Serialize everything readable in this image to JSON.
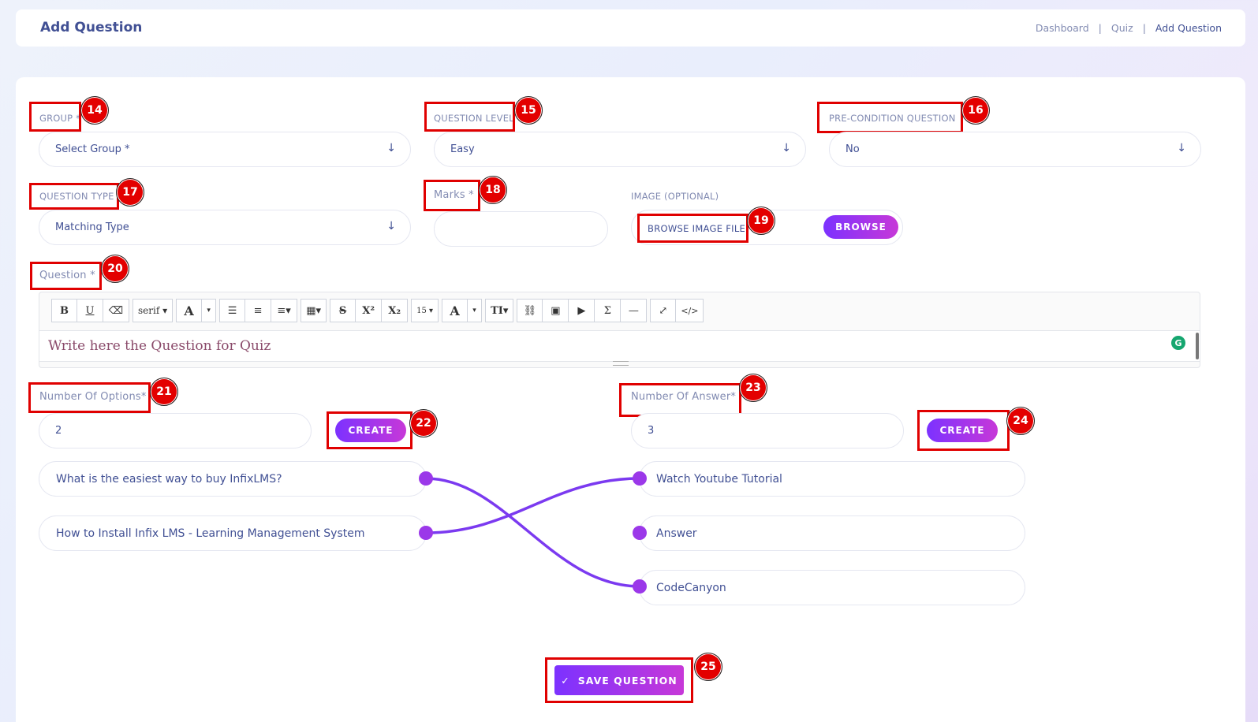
{
  "header": {
    "title": "Add Question",
    "breadcrumb": [
      "Dashboard",
      "|",
      "Quiz",
      "|",
      "Add Question"
    ]
  },
  "form": {
    "group_label": "GROUP *",
    "group_value": "Select Group *",
    "level_label": "QUESTION LEVEL",
    "level_value": "Easy",
    "precond_label": "PRE-CONDITION QUESTION",
    "precond_value": "No",
    "type_label": "QUESTION TYPE",
    "type_value": "Matching Type",
    "marks_label": "Marks *",
    "marks_value": "",
    "image_label": "IMAGE (OPTIONAL)",
    "image_placeholder": "BROWSE IMAGE FILE",
    "browse_label": "BROWSE",
    "question_label": "Question *",
    "question_placeholder": "Write here the Question for Quiz",
    "num_options_label": "Number Of Options*",
    "num_options_value": "2",
    "num_answer_label": "Number Of Answer*",
    "num_answer_value": "3",
    "create_label": "CREATE",
    "save_label": "SAVE QUESTION",
    "save_icon": "✓"
  },
  "editor": {
    "font_name": "serif",
    "font_size": "15"
  },
  "options": [
    "What is the easiest way to buy InfixLMS?",
    "How to Install Infix LMS - Learning Management System"
  ],
  "answers": [
    "Watch Youtube Tutorial",
    "Answer",
    "CodeCanyon"
  ],
  "badges": [
    "14",
    "15",
    "16",
    "17",
    "18",
    "19",
    "20",
    "21",
    "22",
    "23",
    "24",
    "25"
  ],
  "colors": {
    "accent_start": "#7c32ff",
    "accent_end": "#c738d8",
    "annotation_red": "#e30000",
    "text": "#415094"
  }
}
